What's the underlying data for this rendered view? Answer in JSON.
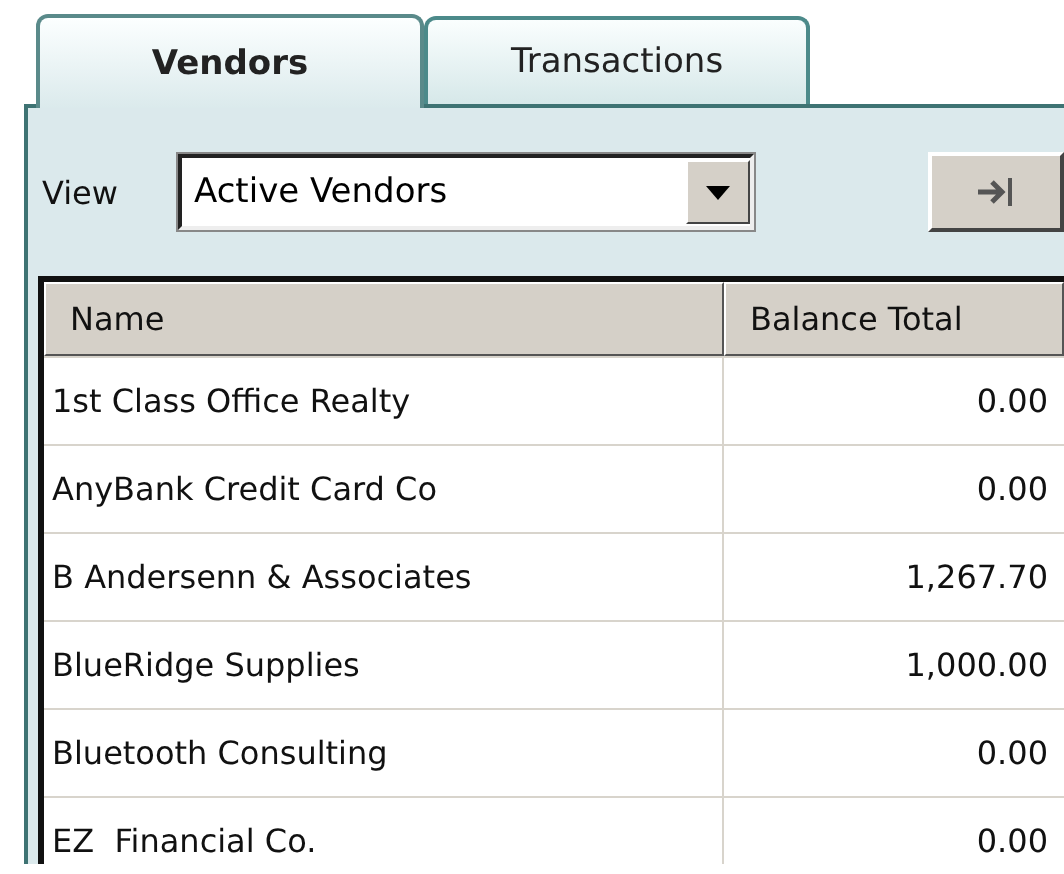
{
  "tabs": [
    {
      "label": "Vendors",
      "selected": true
    },
    {
      "label": "Transactions",
      "selected": false
    }
  ],
  "view": {
    "label": "View",
    "value": "Active Vendors"
  },
  "table": {
    "columns": [
      "Name",
      "Balance Total"
    ],
    "rows": [
      {
        "name": "1st Class Office Realty",
        "balance": "0.00"
      },
      {
        "name": "AnyBank Credit Card Co",
        "balance": "0.00"
      },
      {
        "name": "B Andersenn & Associates",
        "balance": "1,267.70"
      },
      {
        "name": "BlueRidge Supplies",
        "balance": "1,000.00"
      },
      {
        "name": "Bluetooth Consulting",
        "balance": "0.00"
      },
      {
        "name": "EZ  Financial Co.",
        "balance": "0.00"
      }
    ]
  }
}
